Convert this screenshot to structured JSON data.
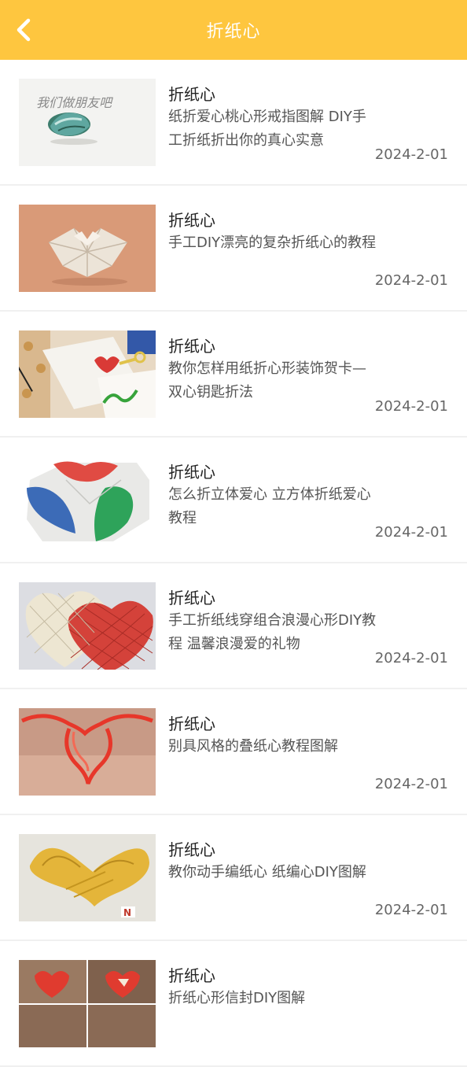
{
  "header": {
    "title": "折纸心",
    "back_icon": "chevron-left-icon",
    "background_color": "#fec63f"
  },
  "items": [
    {
      "title": "折纸心",
      "desc": "纸折爱心桃心形戒指图解 DIY手工折纸折出你的真心实意",
      "date": "2024-2-01",
      "thumb_text": "我们做朋友吧"
    },
    {
      "title": "折纸心",
      "desc": "手工DIY漂亮的复杂折纸心的教程",
      "date": "2024-2-01"
    },
    {
      "title": "折纸心",
      "desc": "教你怎样用纸折心形装饰贺卡—双心钥匙折法",
      "date": "2024-2-01"
    },
    {
      "title": "折纸心",
      "desc": "怎么折立体爱心 立方体折纸爱心教程",
      "date": "2024-2-01"
    },
    {
      "title": "折纸心",
      "desc": "手工折纸线穿组合浪漫心形DIY教程 温馨浪漫爱的礼物",
      "date": "2024-2-01"
    },
    {
      "title": "折纸心",
      "desc": "别具风格的叠纸心教程图解",
      "date": "2024-2-01"
    },
    {
      "title": "折纸心",
      "desc": "教你动手编纸心 纸编心DIY图解",
      "date": "2024-2-01"
    },
    {
      "title": "折纸心",
      "desc": "折纸心形信封DIY图解",
      "date": ""
    }
  ]
}
